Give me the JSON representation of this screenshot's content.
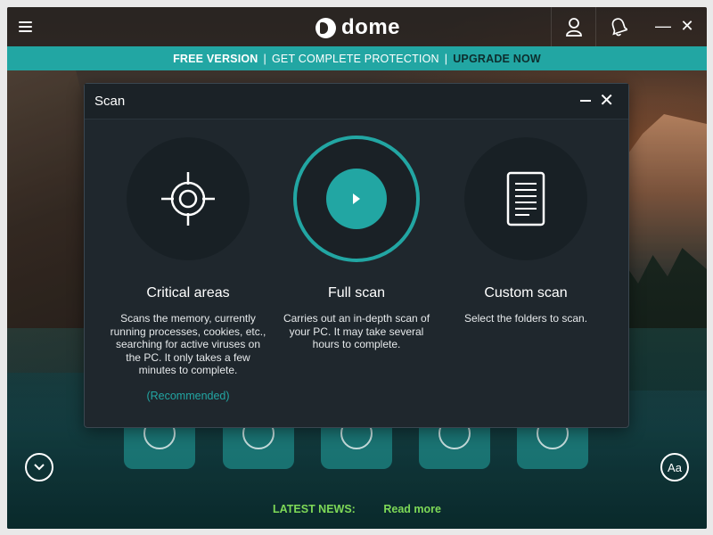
{
  "app": {
    "brand": "dome",
    "colors": {
      "accent": "#22a6a3",
      "news_green": "#7ed957",
      "modal_bg": "#1f272d"
    }
  },
  "promo": {
    "free_version": "FREE VERSION",
    "get_protection": "GET COMPLETE PROTECTION",
    "upgrade": "UPGRADE NOW",
    "separator": "|"
  },
  "icons": {
    "menu": "hamburger-menu-icon",
    "user": "user-icon",
    "notifications": "bell-icon",
    "minimize": "minimize-icon",
    "close": "close-icon",
    "scroll_down": "chevron-down-icon",
    "text_size": "font-size-icon"
  },
  "window": {
    "minimize_glyph": "—",
    "close_glyph": "✕"
  },
  "modal": {
    "title": "Scan",
    "options": [
      {
        "title": "Critical areas",
        "description": "Scans the memory, currently running processes, cookies, etc., searching for active viruses on the PC. It only takes a few minutes to complete.",
        "note": "(Recommended)",
        "icon": "crosshair-icon"
      },
      {
        "title": "Full scan",
        "description": "Carries out an in-depth scan of your PC. It may take several hours to complete.",
        "icon": "play-icon"
      },
      {
        "title": "Custom scan",
        "description": "Select the folders to scan.",
        "icon": "document-icon"
      }
    ]
  },
  "footer": {
    "latest_news_label": "LATEST NEWS:",
    "read_more": "Read more",
    "text_size_label": "Aa"
  }
}
